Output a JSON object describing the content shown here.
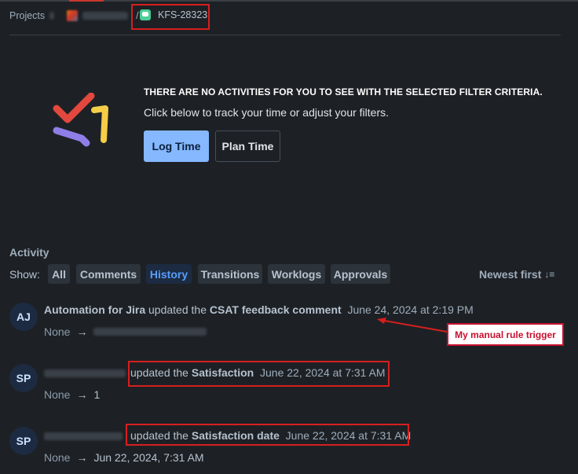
{
  "breadcrumb": {
    "projects_label": "Projects",
    "separator": "/",
    "issue_key": "KFS-28323"
  },
  "empty_state": {
    "title": "THERE ARE NO ACTIVITIES FOR YOU TO SEE WITH THE SELECTED FILTER CRITERIA.",
    "subtitle": "Click below to track your time or adjust your filters.",
    "log_time_label": "Log Time",
    "plan_time_label": "Plan Time"
  },
  "activity": {
    "heading": "Activity",
    "show_label": "Show:",
    "filters": [
      "All",
      "Comments",
      "History",
      "Transitions",
      "Worklogs",
      "Approvals"
    ],
    "active_filter": "History",
    "sort_label": "Newest first"
  },
  "entries": [
    {
      "initials": "AJ",
      "author": "Automation for Jira",
      "action": "updated the",
      "field": "CSAT feedback comment",
      "date": "June 24, 2024 at 2:19 PM",
      "old_value": "None",
      "arrow": "→",
      "new_value": ""
    },
    {
      "initials": "SP",
      "author": "",
      "action": "updated the",
      "field": "Satisfaction",
      "date": "June 22, 2024 at 7:31 AM",
      "old_value": "None",
      "arrow": "→",
      "new_value": "1"
    },
    {
      "initials": "SP",
      "author": "",
      "action": "updated the",
      "field": "Satisfaction date",
      "date": "June 22, 2024 at 7:31 AM",
      "old_value": "None",
      "arrow": "→",
      "new_value": "Jun 22, 2024, 7:31 AM"
    }
  ],
  "annotation": {
    "callout_text": "My manual rule trigger"
  },
  "colors": {
    "background": "#1d2125",
    "primary_button": "#85b8ff",
    "active_filter": "#579dff",
    "annotation_red": "#d61f1f"
  },
  "icons": [
    "chat-issue-icon",
    "sort-descending-icon",
    "empty-state-illustration"
  ]
}
